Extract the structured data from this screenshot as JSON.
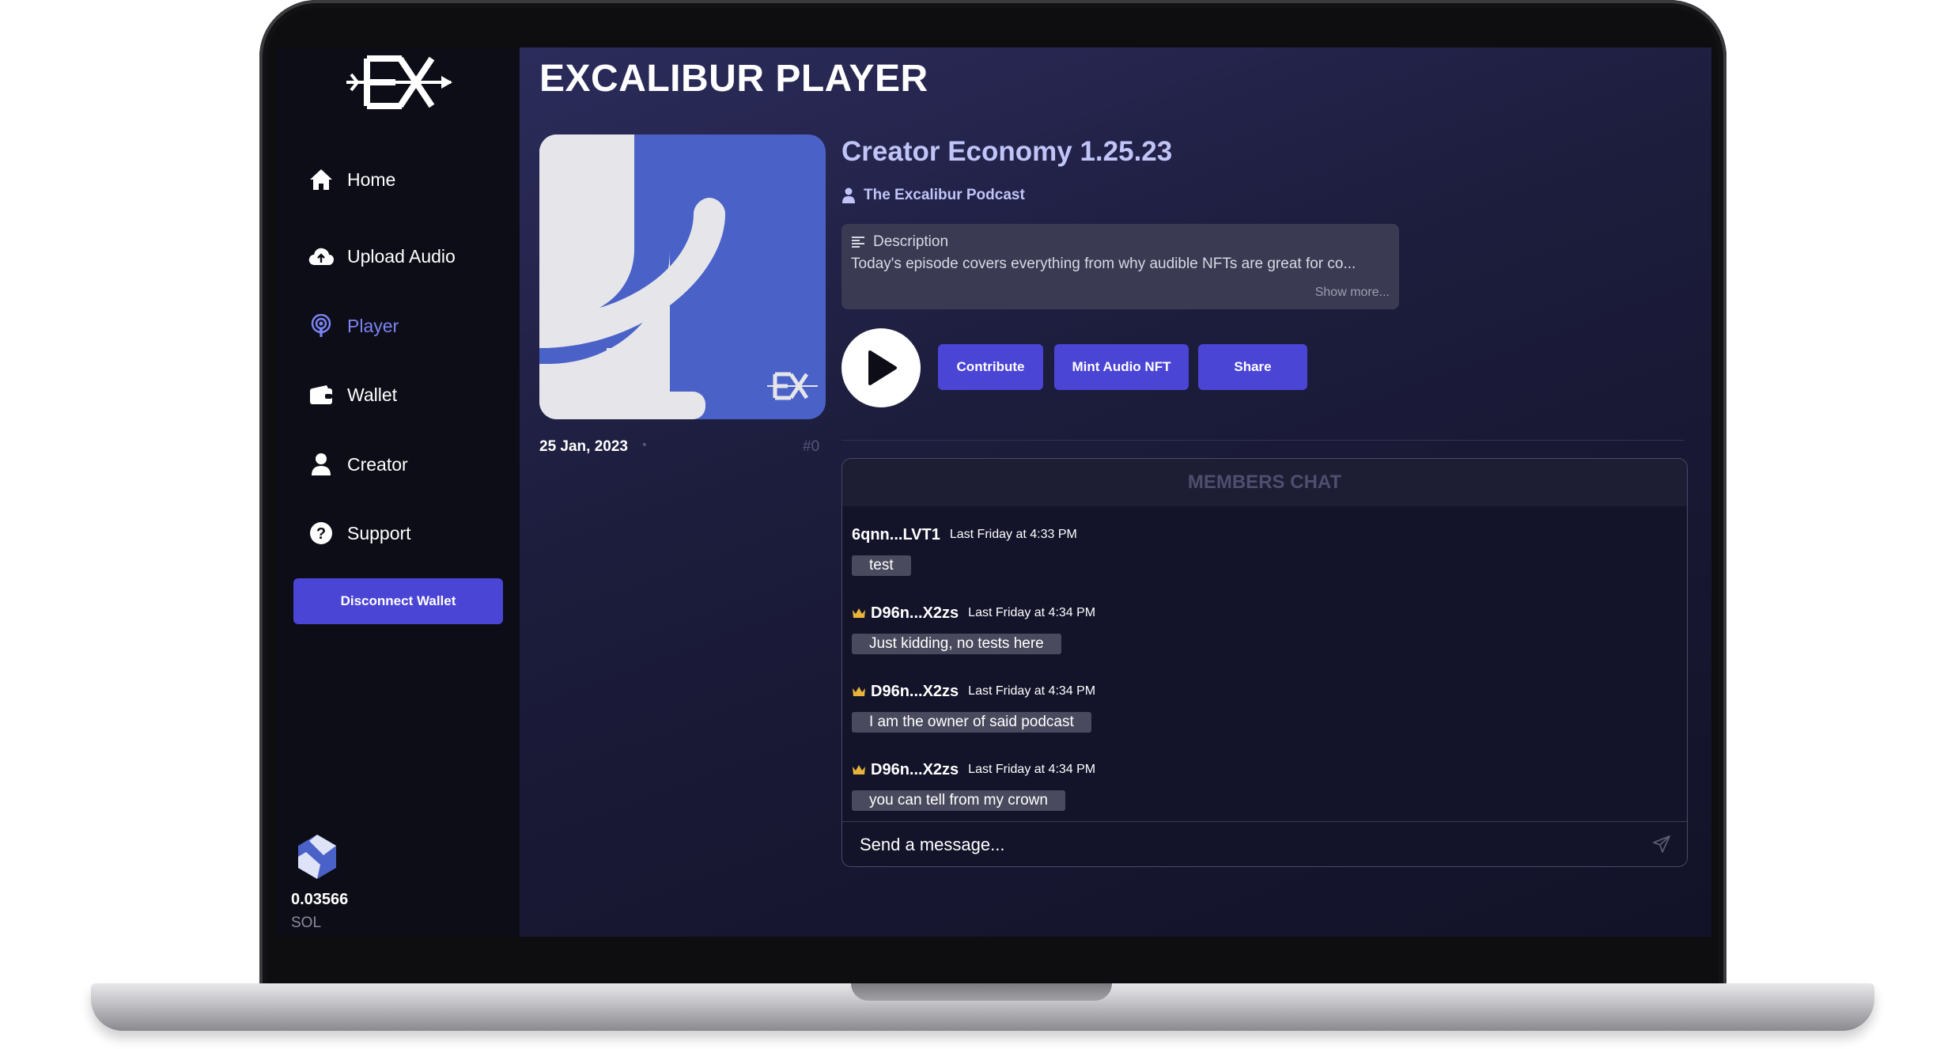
{
  "sidebar": {
    "items": [
      {
        "label": "Home",
        "icon": "home-icon"
      },
      {
        "label": "Upload Audio",
        "icon": "cloud-upload-icon"
      },
      {
        "label": "Player",
        "icon": "podcast-icon"
      },
      {
        "label": "Wallet",
        "icon": "wallet-icon"
      },
      {
        "label": "Creator",
        "icon": "user-icon"
      },
      {
        "label": "Support",
        "icon": "help-icon"
      }
    ],
    "active_item": "Player",
    "disconnect_label": "Disconnect Wallet",
    "balance": {
      "amount": "0.03566",
      "unit": "SOL"
    }
  },
  "page": {
    "title": "EXCALIBUR PLAYER"
  },
  "episode": {
    "title": "Creator Economy 1.25.23",
    "podcast": "The Excalibur Podcast",
    "description_label": "Description",
    "description": "Today's episode covers everything from why audible NFTs are great for co...",
    "show_more": "Show more...",
    "date": "25 Jan, 2023",
    "dot": "•",
    "number": "#0"
  },
  "actions": {
    "contribute": "Contribute",
    "mint": "Mint Audio NFT",
    "share": "Share"
  },
  "chat": {
    "title": "MEMBERS CHAT",
    "messages": [
      {
        "user": "6qnn...LVT1",
        "time": "Last Friday at 4:33 PM",
        "text": "test",
        "crown": false
      },
      {
        "user": "D96n...X2zs",
        "time": "Last Friday at 4:34 PM",
        "text": "Just kidding, no tests here",
        "crown": true
      },
      {
        "user": "D96n...X2zs",
        "time": "Last Friday at 4:34 PM",
        "text": "I am the owner of said podcast",
        "crown": true
      },
      {
        "user": "D96n...X2zs",
        "time": "Last Friday at 4:34 PM",
        "text": "you can tell from my crown",
        "crown": true
      }
    ],
    "input_placeholder": "Send a message..."
  },
  "colors": {
    "accent": "#4b45d6",
    "active_nav": "#7b83f2",
    "cover_blue": "#4a62c8",
    "title_lavender": "#c0c4f6"
  }
}
